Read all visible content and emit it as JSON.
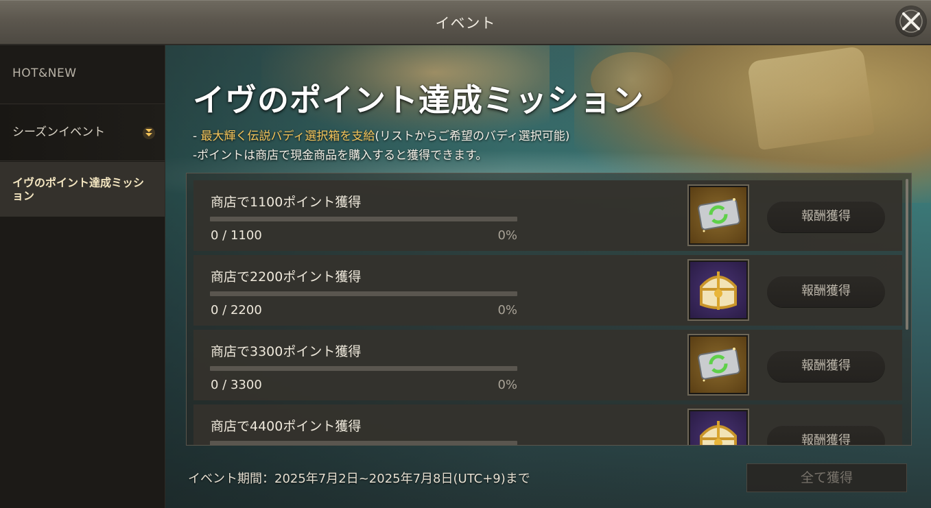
{
  "window": {
    "title": "イベント"
  },
  "sidebar": {
    "items": [
      {
        "label": "HOT&NEW"
      },
      {
        "label": "シーズンイベント"
      },
      {
        "label": "イヴのポイント達成ミッション"
      }
    ]
  },
  "event": {
    "title": "イヴのポイント達成ミッション",
    "desc1_prefix": "- ",
    "desc1_highlight": "最大輝く伝説バディ選択箱を支給",
    "desc1_suffix": "(リストからご希望のバディ選択可能)",
    "desc2": "-ポイントは商店で現金商品を購入すると獲得できます。",
    "period": "イベント期間：2025年7月2日~2025年7月8日(UTC+9)まで",
    "claim_all": "全て獲得"
  },
  "missions": [
    {
      "label": "商店で1100ポイント獲得",
      "progress": "0 / 1100",
      "percent": "0%",
      "fraction": 0,
      "reward": "ticket-icon",
      "button": "報酬獲得"
    },
    {
      "label": "商店で2200ポイント獲得",
      "progress": "0 / 2200",
      "percent": "0%",
      "fraction": 0,
      "reward": "chest-icon",
      "button": "報酬獲得"
    },
    {
      "label": "商店で3300ポイント獲得",
      "progress": "0 / 3300",
      "percent": "0%",
      "fraction": 0,
      "reward": "ticket-icon",
      "button": "報酬獲得"
    },
    {
      "label": "商店で4400ポイント獲得",
      "progress": "",
      "percent": "",
      "fraction": 0,
      "reward": "chest-icon",
      "button": "報酬獲得"
    }
  ],
  "colors": {
    "highlight": "#f4c45a",
    "progress_fill": "#d6b35b"
  }
}
